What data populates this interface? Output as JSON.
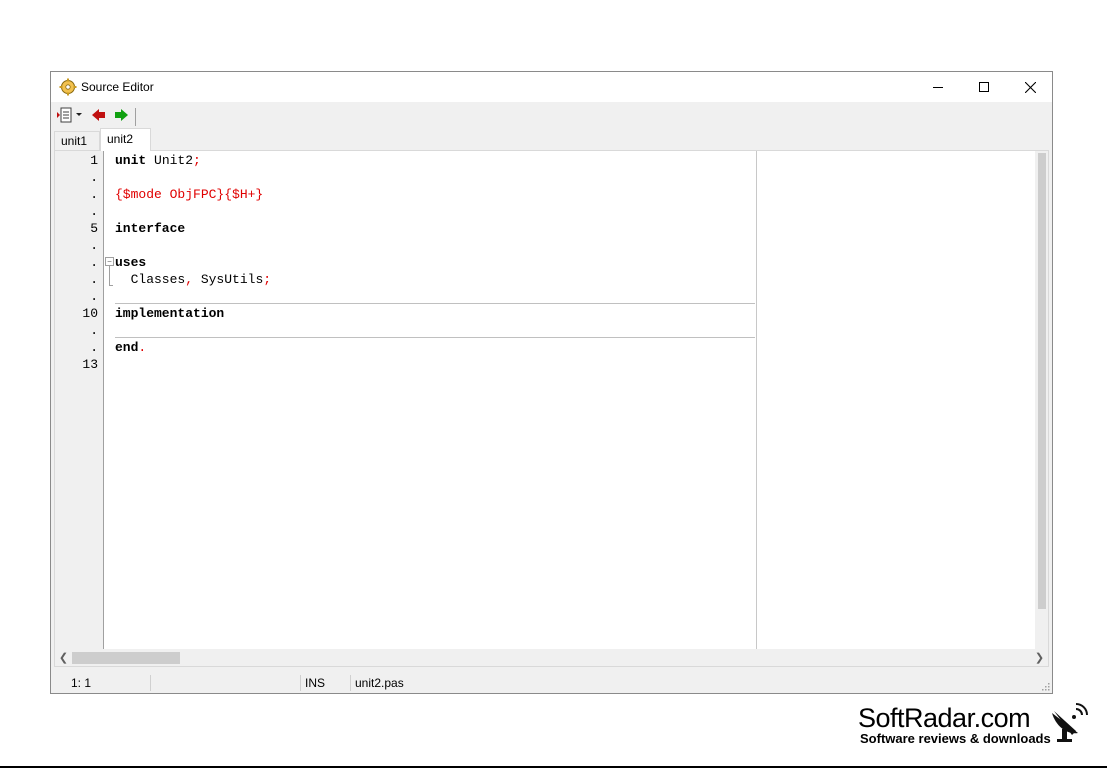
{
  "window": {
    "title": "Source Editor",
    "controls": {
      "minimize": "minimize",
      "maximize": "maximize",
      "close": "close"
    }
  },
  "toolbar": {
    "items": [
      {
        "icon": "document-menu-icon"
      },
      {
        "icon": "back-arrow-icon",
        "color": "#c01010"
      },
      {
        "icon": "forward-arrow-icon",
        "color": "#10a010"
      }
    ]
  },
  "tabs": [
    {
      "label": "unit1",
      "active": false
    },
    {
      "label": "unit2",
      "active": true
    }
  ],
  "gutter": {
    "line_markers": [
      "1",
      ".",
      ".",
      ".",
      "5",
      ".",
      ".",
      ".",
      ".",
      "10",
      ".",
      ".",
      "13"
    ]
  },
  "code": {
    "lines": [
      {
        "parts": [
          {
            "text": "unit",
            "cls": "kw"
          },
          {
            "text": " Unit2",
            "cls": ""
          },
          {
            "text": ";",
            "cls": "sym"
          }
        ]
      },
      {
        "parts": []
      },
      {
        "parts": [
          {
            "text": "{$mode ObjFPC}{$H+}",
            "cls": "dir"
          }
        ]
      },
      {
        "parts": []
      },
      {
        "parts": [
          {
            "text": "interface",
            "cls": "kw"
          }
        ]
      },
      {
        "parts": []
      },
      {
        "parts": [
          {
            "text": "uses",
            "cls": "kw"
          }
        ]
      },
      {
        "parts": [
          {
            "text": "  Classes",
            "cls": ""
          },
          {
            "text": ",",
            "cls": "sym"
          },
          {
            "text": " SysUtils",
            "cls": ""
          },
          {
            "text": ";",
            "cls": "sym"
          }
        ]
      },
      {
        "parts": []
      },
      {
        "parts": [
          {
            "text": "implementation",
            "cls": "kw"
          }
        ]
      },
      {
        "parts": []
      },
      {
        "parts": [
          {
            "text": "end",
            "cls": "kw"
          },
          {
            "text": ".",
            "cls": "sym"
          }
        ]
      },
      {
        "parts": []
      }
    ]
  },
  "status": {
    "position": "1:  1",
    "mode": "INS",
    "filename": "unit2.pas"
  },
  "watermark": {
    "name": "SoftRadar.com",
    "tagline": "Software reviews & downloads"
  }
}
